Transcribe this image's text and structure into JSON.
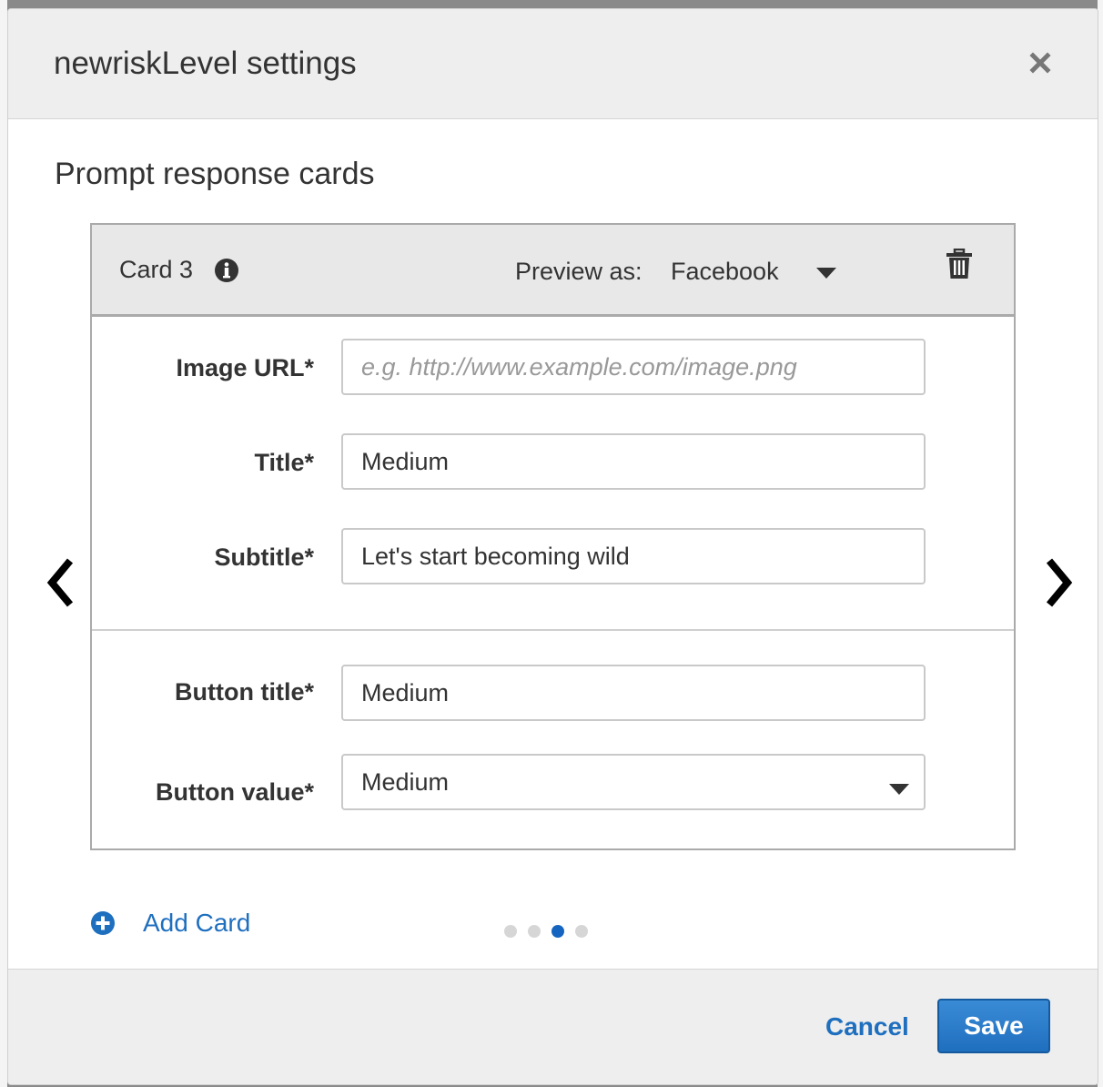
{
  "modal": {
    "title": "newriskLevel settings",
    "section_title": "Prompt response cards"
  },
  "card": {
    "label": "Card 3",
    "preview_label": "Preview as:",
    "preview_value": "Facebook",
    "fields": {
      "image_url": {
        "label": "Image URL*",
        "value": "",
        "placeholder": "e.g. http://www.example.com/image.png"
      },
      "title": {
        "label": "Title*",
        "value": "Medium"
      },
      "subtitle": {
        "label": "Subtitle*",
        "value": "Let's start becoming wild"
      },
      "button_title": {
        "label": "Button title*",
        "value": "Medium"
      },
      "button_value": {
        "label": "Button value*",
        "value": "Medium"
      }
    }
  },
  "add_card_label": "Add Card",
  "pagination": {
    "total": 4,
    "active_index": 2
  },
  "footer": {
    "cancel_label": "Cancel",
    "save_label": "Save"
  },
  "colors": {
    "accent": "#1f6fbf",
    "header_bg": "#eeeeee",
    "card_header_bg": "#e8e8e8"
  },
  "icons": [
    "close-icon",
    "info-icon",
    "caret-down-icon",
    "trash-icon",
    "chevron-left-icon",
    "chevron-right-icon",
    "plus-circle-icon"
  ]
}
